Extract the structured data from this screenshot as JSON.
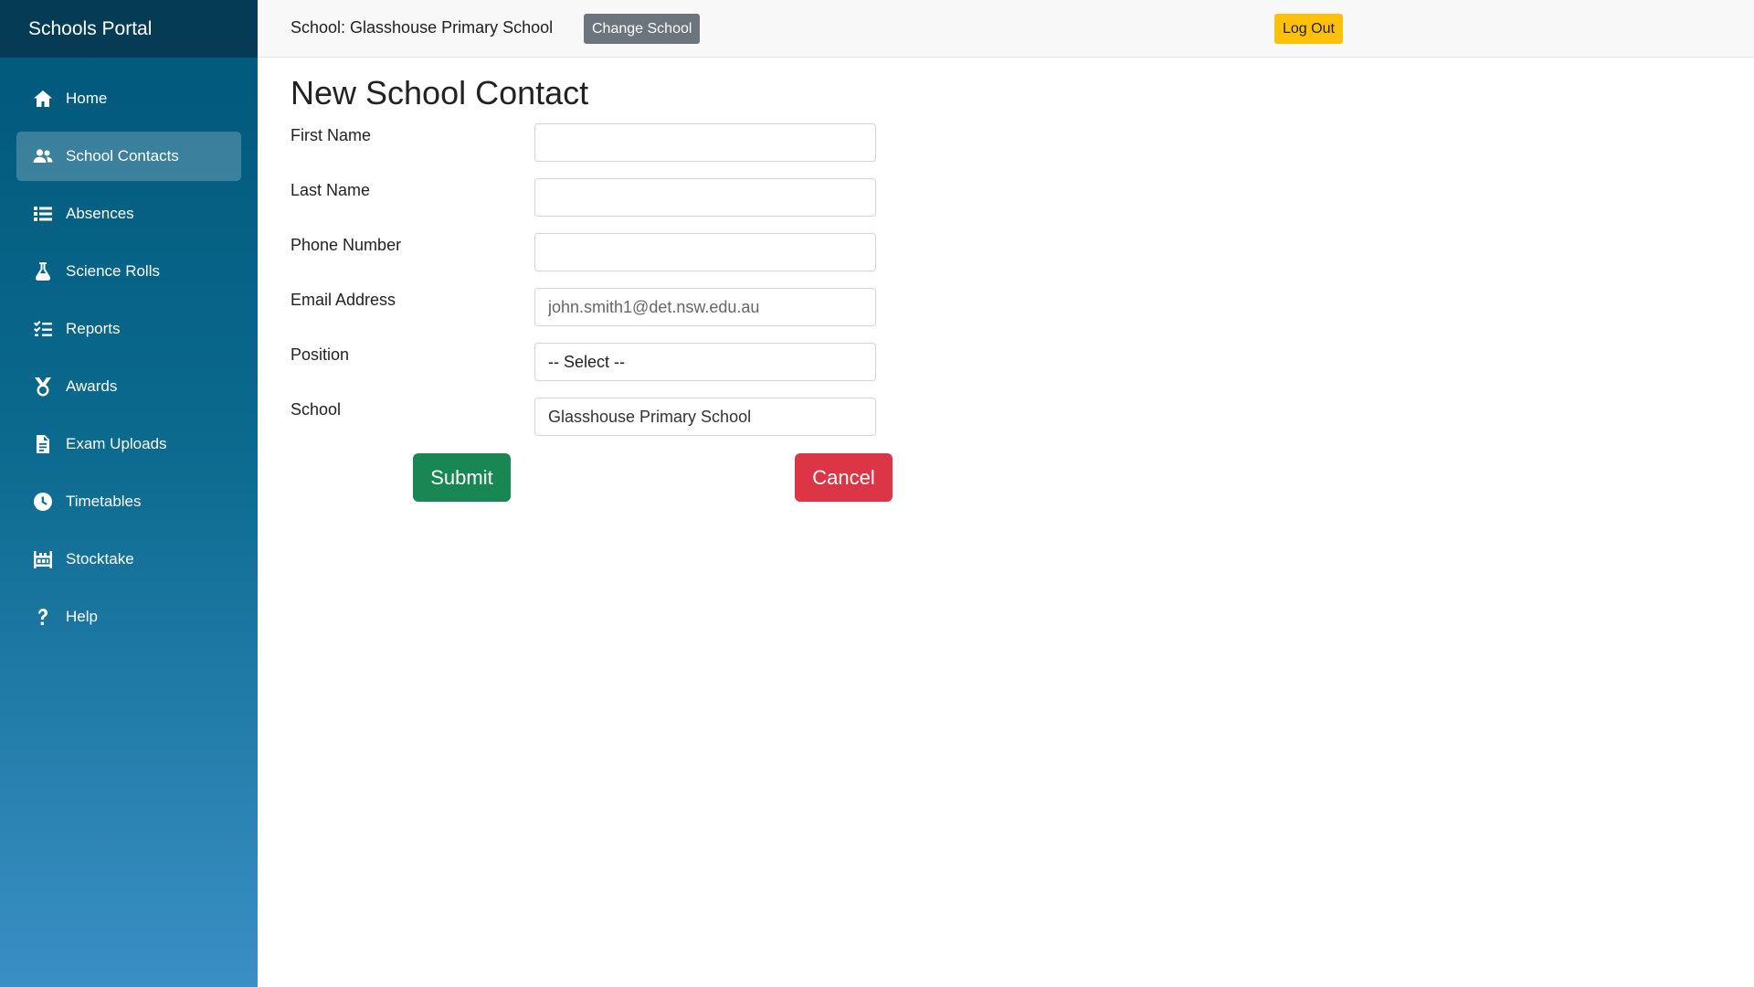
{
  "app": {
    "brand": "Schools Portal"
  },
  "sidebar": {
    "items": [
      {
        "label": "Home",
        "icon": "home-icon"
      },
      {
        "label": "School Contacts",
        "icon": "users-icon",
        "active": true
      },
      {
        "label": "Absences",
        "icon": "list-icon"
      },
      {
        "label": "Science Rolls",
        "icon": "flask-icon"
      },
      {
        "label": "Reports",
        "icon": "checklist-icon"
      },
      {
        "label": "Awards",
        "icon": "medal-icon"
      },
      {
        "label": "Exam Uploads",
        "icon": "file-icon"
      },
      {
        "label": "Timetables",
        "icon": "clock-icon"
      },
      {
        "label": "Stocktake",
        "icon": "warehouse-icon"
      },
      {
        "label": "Help",
        "icon": "question-icon"
      }
    ]
  },
  "header": {
    "school_label": "School: Glasshouse Primary School",
    "change_school_label": "Change School",
    "logout_label": "Log Out"
  },
  "form": {
    "title": "New School Contact",
    "first_name": {
      "label": "First Name",
      "value": ""
    },
    "last_name": {
      "label": "Last Name",
      "value": ""
    },
    "phone": {
      "label": "Phone Number",
      "value": ""
    },
    "email": {
      "label": "Email Address",
      "placeholder": "john.smith1@det.nsw.edu.au"
    },
    "position": {
      "label": "Position",
      "selected": "-- Select --"
    },
    "school": {
      "label": "School",
      "value": "Glasshouse Primary School"
    },
    "submit_label": "Submit",
    "cancel_label": "Cancel"
  },
  "colors": {
    "brand_dark": "#053b55",
    "sidebar_top": "#00577a",
    "sidebar_bottom": "#3a8fc4",
    "submit": "#198754",
    "cancel": "#dc3545",
    "logout": "#ffc107",
    "change_school": "#6c757d"
  }
}
